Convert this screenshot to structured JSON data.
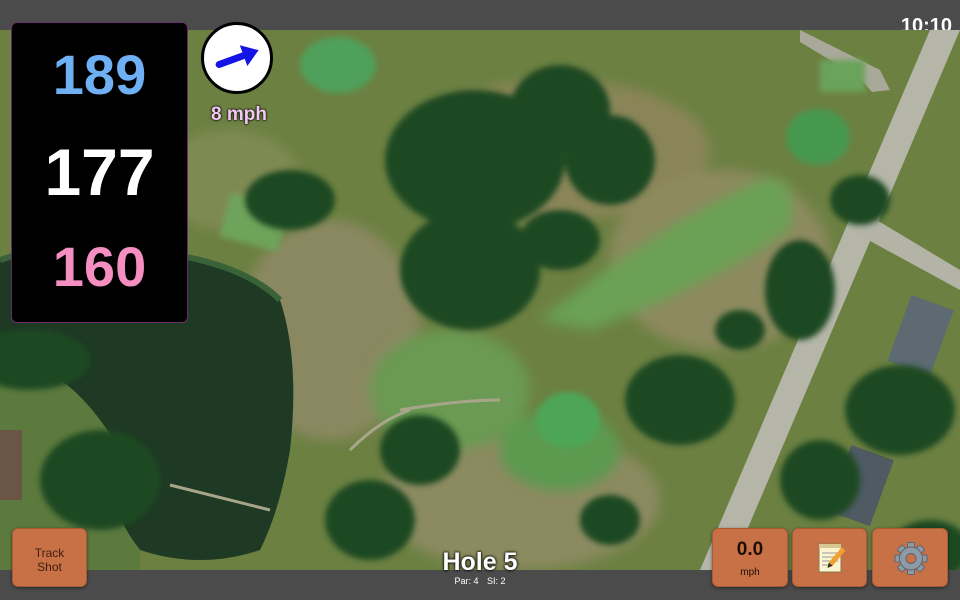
{
  "status_bar": {
    "time": "10:10"
  },
  "distances": {
    "back": "189",
    "middle": "177",
    "front": "160"
  },
  "wind": {
    "speed": "8 mph",
    "icon": "wind-arrow-icon"
  },
  "buttons": {
    "track_shot": {
      "line1": "Track",
      "line2": "Shot"
    },
    "speed": {
      "value": "0.0",
      "unit": "mph"
    },
    "notes": {
      "icon": "notepad-icon"
    },
    "settings": {
      "icon": "gear-icon"
    }
  },
  "hole": {
    "title": "Hole 5",
    "par": "Par: 4",
    "si": "SI: 2"
  },
  "colors": {
    "back": "#6fb0f5",
    "middle": "#ffffff",
    "front": "#f58fc2",
    "button": "#c87046",
    "wind_arrow": "#1414e6"
  }
}
